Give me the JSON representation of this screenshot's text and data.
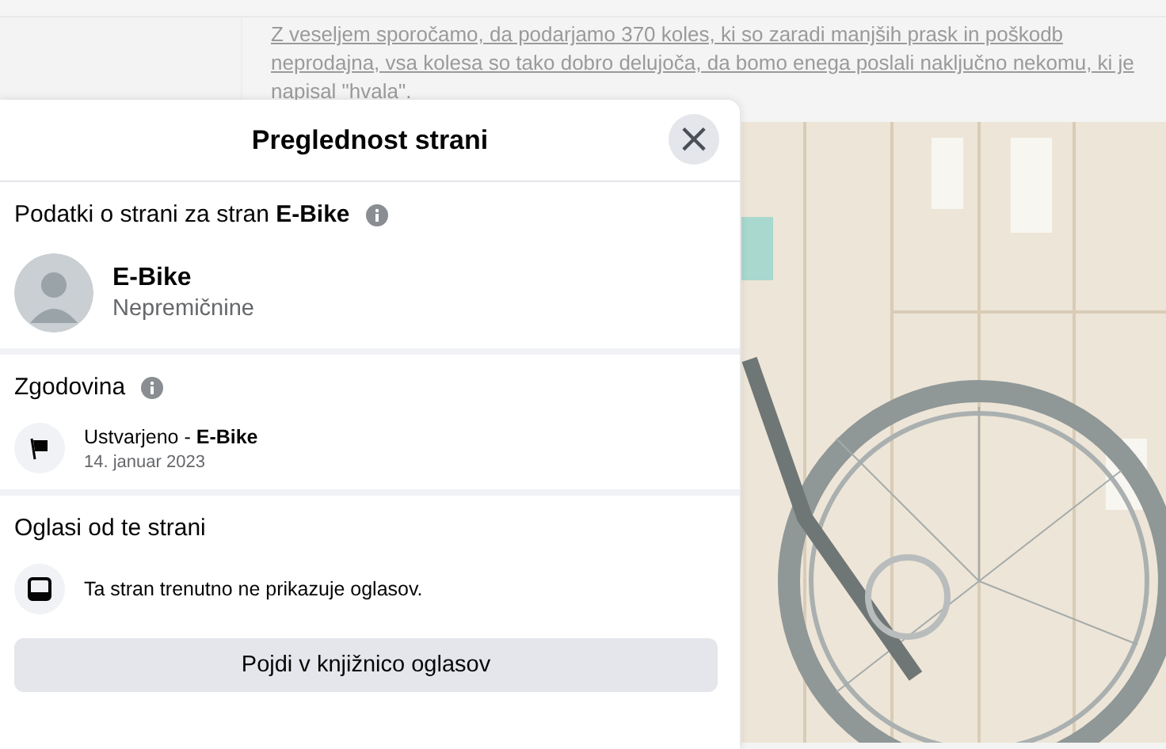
{
  "post_text": "Z veseljem sporočamo, da podarjamo 370 koles, ki so zaradi manjših prask in poškodb neprodajna, vsa kolesa so tako dobro delujoča, da bomo enega poslali naključno nekomu, ki je napisal \"hvala\".",
  "dialog": {
    "title": "Preglednost strani",
    "close_label": "×",
    "page_info": {
      "heading": "Podatki o strani za stran **E-Bike**",
      "has_info": true,
      "name": "E-Bike",
      "category": "Nepremičnine"
    },
    "history": {
      "heading": "Zgodovina",
      "has_info": true,
      "events": [
        {
          "text": "Ustvarjeno - **E-Bike**",
          "date": "14. januar 2023"
        }
      ]
    },
    "ads": {
      "heading": "Oglasi od te strani",
      "has_info": false,
      "message": "Ta stran trenutno ne prikazuje oglasov.",
      "button": "Pojdi v knjižnico oglasov"
    }
  }
}
